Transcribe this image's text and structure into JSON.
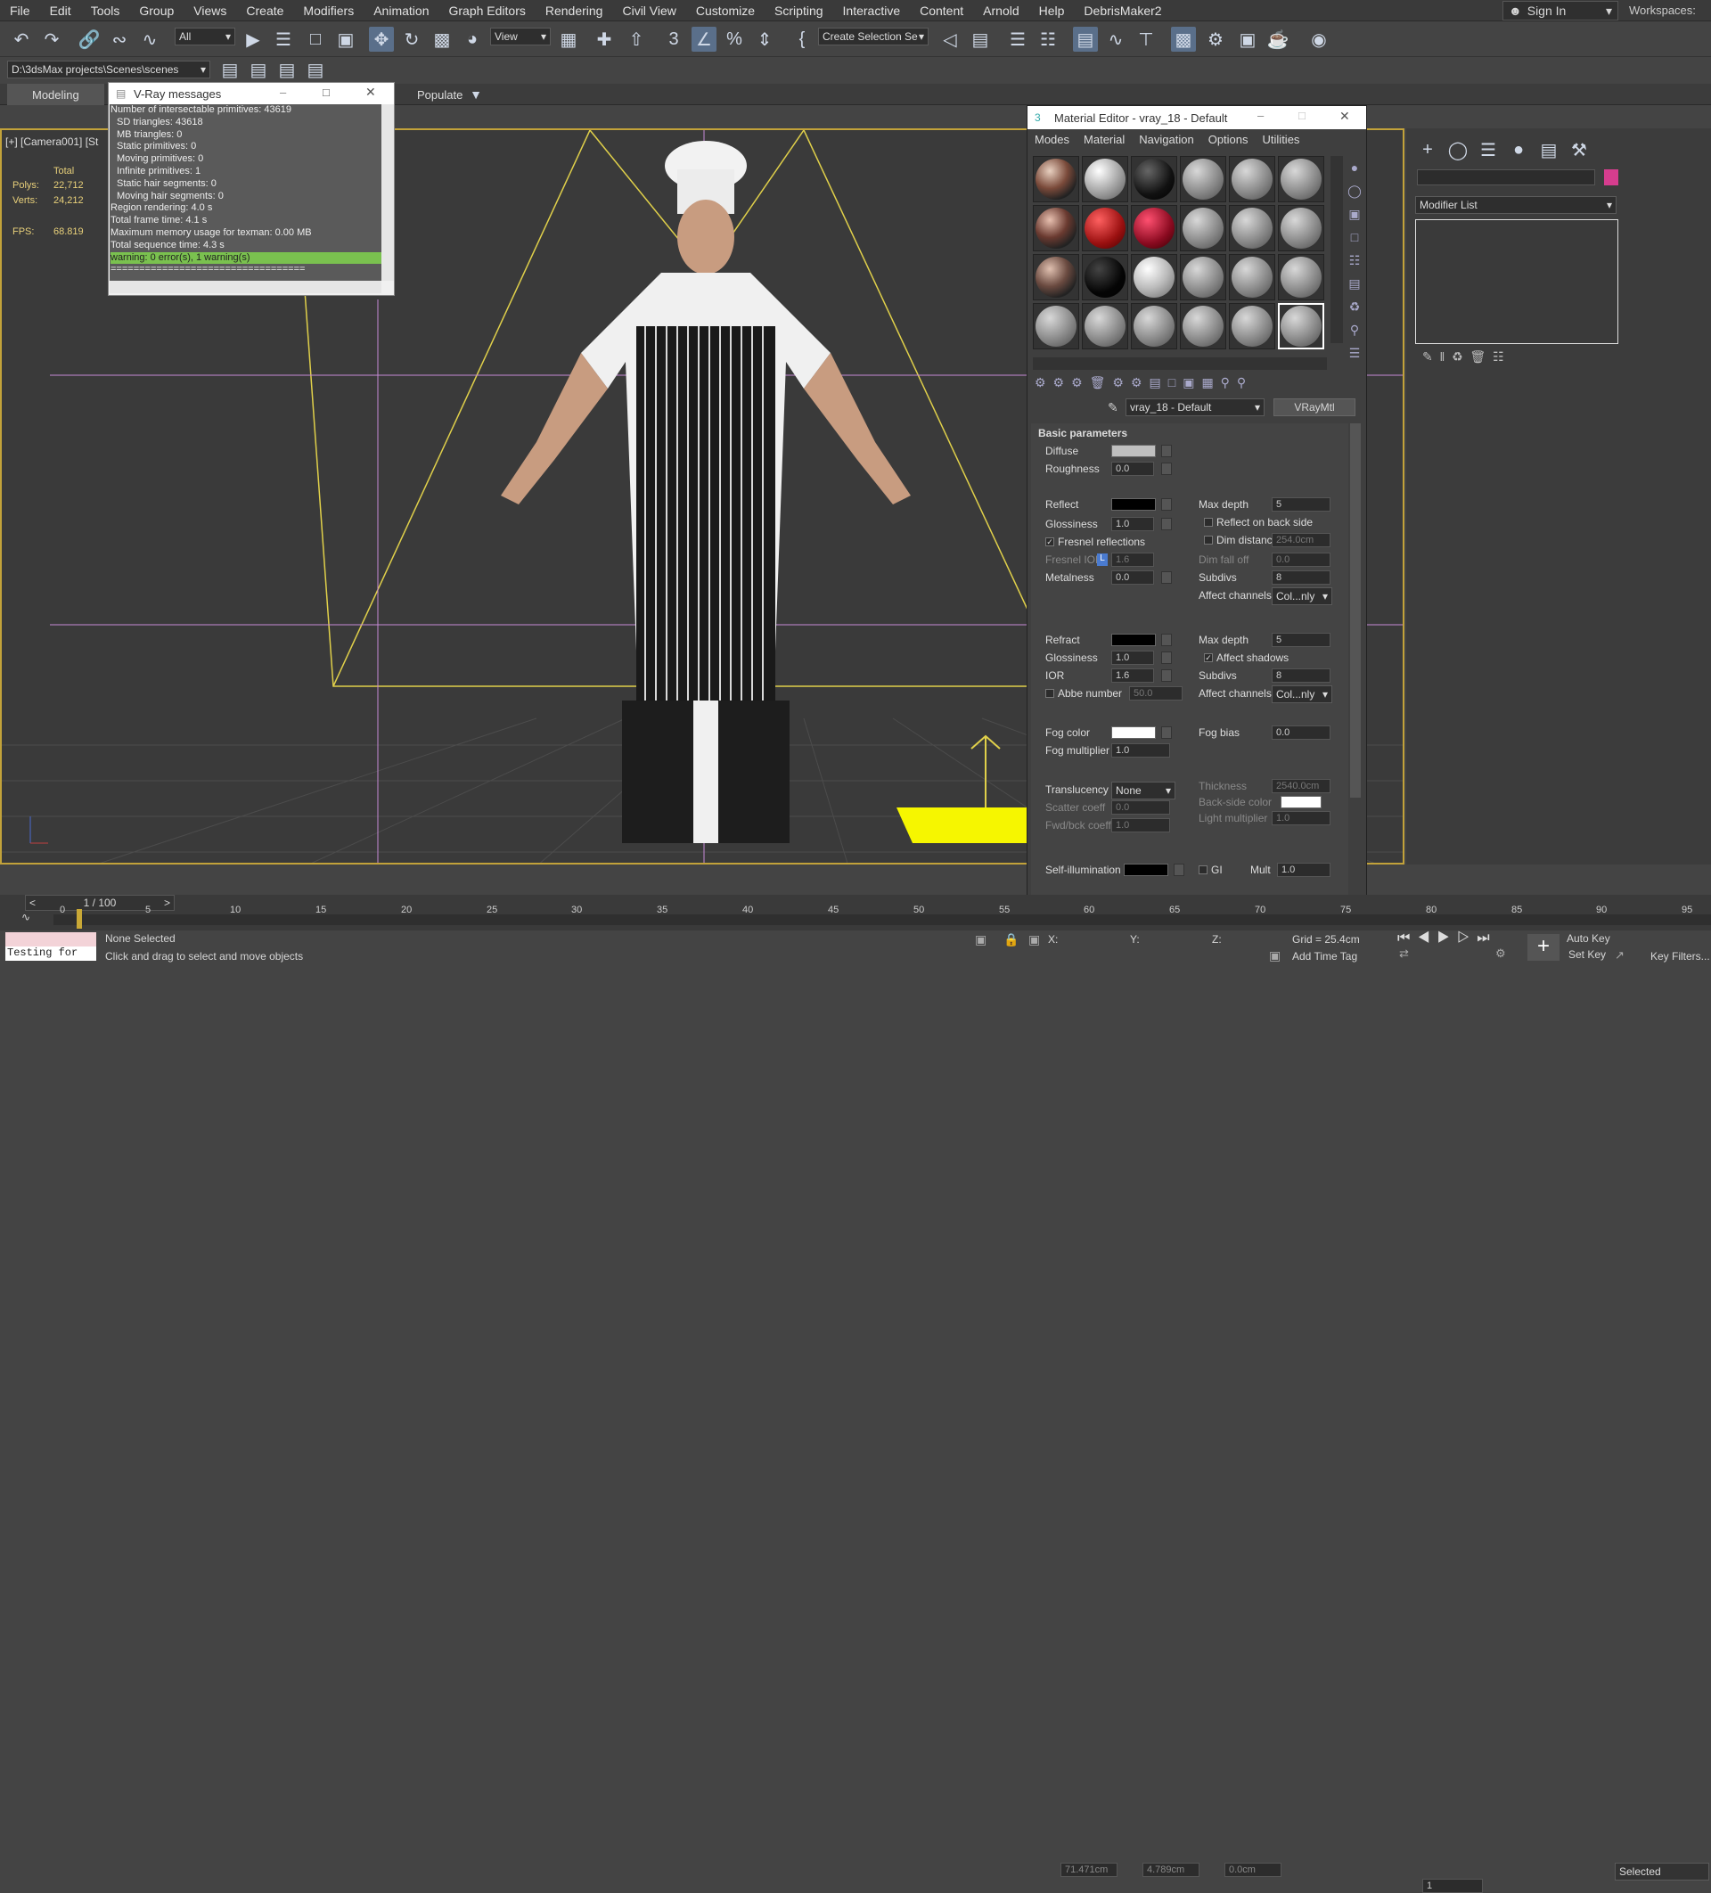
{
  "menu": [
    "File",
    "Edit",
    "Tools",
    "Group",
    "Views",
    "Create",
    "Modifiers",
    "Animation",
    "Graph Editors",
    "Rendering",
    "Civil View",
    "Customize",
    "Scripting",
    "Interactive",
    "Content",
    "Arnold",
    "Help",
    "DebrisMaker2"
  ],
  "signin": "Sign In",
  "workspaces": "Workspaces:",
  "toolbar": {
    "filter": "All",
    "refcoord": "View",
    "selection_set": "Create Selection Se"
  },
  "project_path": "D:\\3dsMax projects\\Scenes\\scenes",
  "ribbon": {
    "tab_modeling": "Modeling",
    "tab_populate": "Populate"
  },
  "viewport": {
    "label": "[+] [Camera001] [St",
    "stats_header": "Total",
    "polys_label": "Polys:",
    "polys": "22,712",
    "verts_label": "Verts:",
    "verts": "24,212",
    "fps_label": "FPS:",
    "fps": "68.819"
  },
  "vray": {
    "title": "V-Ray messages",
    "lines": [
      "Number of intersectable primitives: 43619",
      "SD triangles: 43618",
      "MB triangles: 0",
      "Static primitives: 0",
      "Moving primitives: 0",
      "Infinite primitives: 1",
      "Static hair segments: 0",
      "Moving hair segments: 0",
      "Region rendering: 4.0 s",
      "Total frame time: 4.1 s",
      "Maximum memory usage for texman: 0.00 MB",
      "Total sequence time: 4.3 s"
    ],
    "highlight": "warning: 0 error(s), 1 warning(s)",
    "sep": "=================================="
  },
  "mat": {
    "title": "Material Editor - vray_18 - Default",
    "menus": [
      "Modes",
      "Material",
      "Navigation",
      "Options",
      "Utilities"
    ],
    "name": "vray_18 - Default",
    "type": "VRayMtl",
    "rollout": "Basic parameters",
    "diffuse": "Diffuse",
    "roughness": "Roughness",
    "roughness_v": "0.0",
    "reflect": "Reflect",
    "glossiness": "Glossiness",
    "gloss_v": "1.0",
    "fresnel": "Fresnel reflections",
    "fresnel_ior": "Fresnel IOR",
    "fresnel_ior_v": "1.6",
    "fresnel_l": "L",
    "metalness": "Metalness",
    "metal_v": "0.0",
    "maxdepth": "Max depth",
    "maxdepth_v": "5",
    "reflback": "Reflect on back side",
    "dimdist": "Dim distance",
    "dimdist_v": "254.0cm",
    "dimfall": "Dim fall off",
    "dimfall_v": "0.0",
    "subdivs": "Subdivs",
    "subdivs_v": "8",
    "affect": "Affect channels",
    "affect_v": "Col...nly",
    "refract": "Refract",
    "rglossiness": "Glossiness",
    "rgloss_v": "1.0",
    "ior": "IOR",
    "ior_v": "1.6",
    "abbe": "Abbe number",
    "abbe_v": "50.0",
    "rmaxdepth_v": "5",
    "affectshadows": "Affect shadows",
    "rsubdivs_v": "8",
    "raffect_v": "Col...nly",
    "fogcolor": "Fog color",
    "fogmult": "Fog multiplier",
    "fogmult_v": "1.0",
    "fogbias": "Fog bias",
    "fogbias_v": "0.0",
    "transl": "Translucency",
    "transl_v": "None",
    "scatter": "Scatter coeff",
    "scatter_v": "0.0",
    "fwdbck": "Fwd/bck coeff",
    "fwdbck_v": "1.0",
    "thickness": "Thickness",
    "thickness_v": "2540.0cm",
    "backside": "Back-side color",
    "lightmult": "Light multiplier",
    "lightmult_v": "1.0",
    "selfillum": "Self-illumination",
    "gi": "GI",
    "mult": "Mult",
    "mult_v": "1.0"
  },
  "modifier_list": "Modifier List",
  "timeline": {
    "frame": "1 / 100",
    "ticks": [
      "0",
      "5",
      "10",
      "15",
      "20",
      "25",
      "30",
      "35",
      "40",
      "45",
      "50",
      "55",
      "60",
      "65",
      "70",
      "75",
      "80",
      "85",
      "90",
      "95"
    ]
  },
  "status": {
    "script": "Testing for",
    "selected": "None Selected",
    "hint": "Click and drag to select and move objects",
    "x_label": "X:",
    "x": "71.471cm",
    "y_label": "Y:",
    "y": "4.789cm",
    "z_label": "Z:",
    "z": "0.0cm",
    "grid": "Grid = 25.4cm",
    "addtime": "Add Time Tag",
    "autokey": "Auto Key",
    "setkey": "Set Key",
    "selectedset": "Selected",
    "keyfilters": "Key Filters...",
    "frame_field": "1"
  },
  "colors": {
    "accent": "#c2a23a",
    "select": "#5cbf5c",
    "vraygreen": "#7ac14f"
  }
}
